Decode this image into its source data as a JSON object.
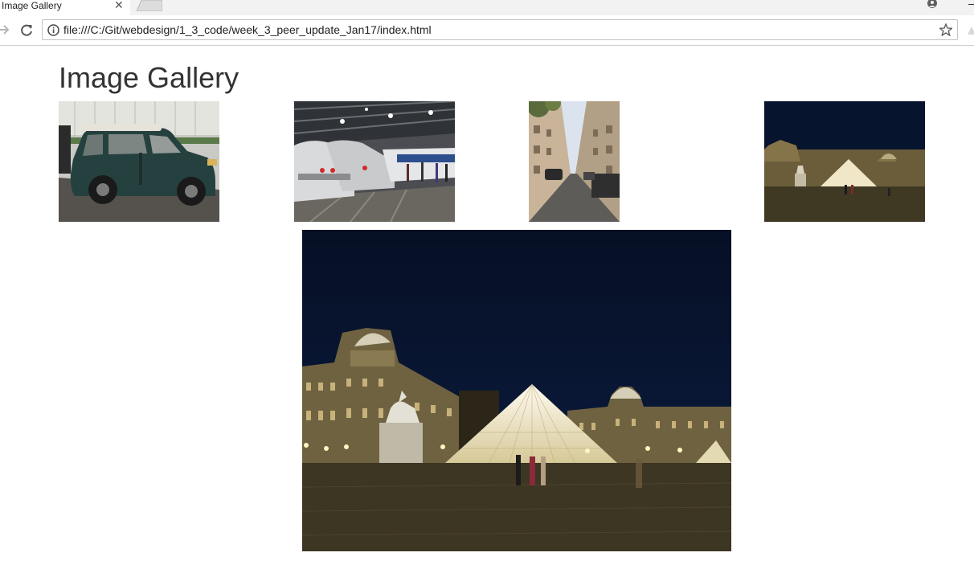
{
  "browser": {
    "tab": {
      "title": "Image Gallery",
      "close_glyph": "✕"
    },
    "address_bar": {
      "url": "file:///C:/Git/webdesign/1_3_code/week_3_peer_update_Jan17/index.html"
    },
    "icons": [
      "forward-icon",
      "reload-icon",
      "info-icon",
      "star-icon",
      "profile-icon",
      "extension-icon"
    ]
  },
  "page": {
    "title": "Image Gallery",
    "thumbnails": [
      {
        "subject": "mini-car"
      },
      {
        "subject": "trains"
      },
      {
        "subject": "street"
      },
      {
        "subject": "louvre"
      }
    ],
    "featured": {
      "subject": "louvre"
    }
  },
  "colors": {
    "title": "#333333",
    "night_sky": "#07142e",
    "pyramid": "#efe7c8",
    "car": "#25413f"
  }
}
